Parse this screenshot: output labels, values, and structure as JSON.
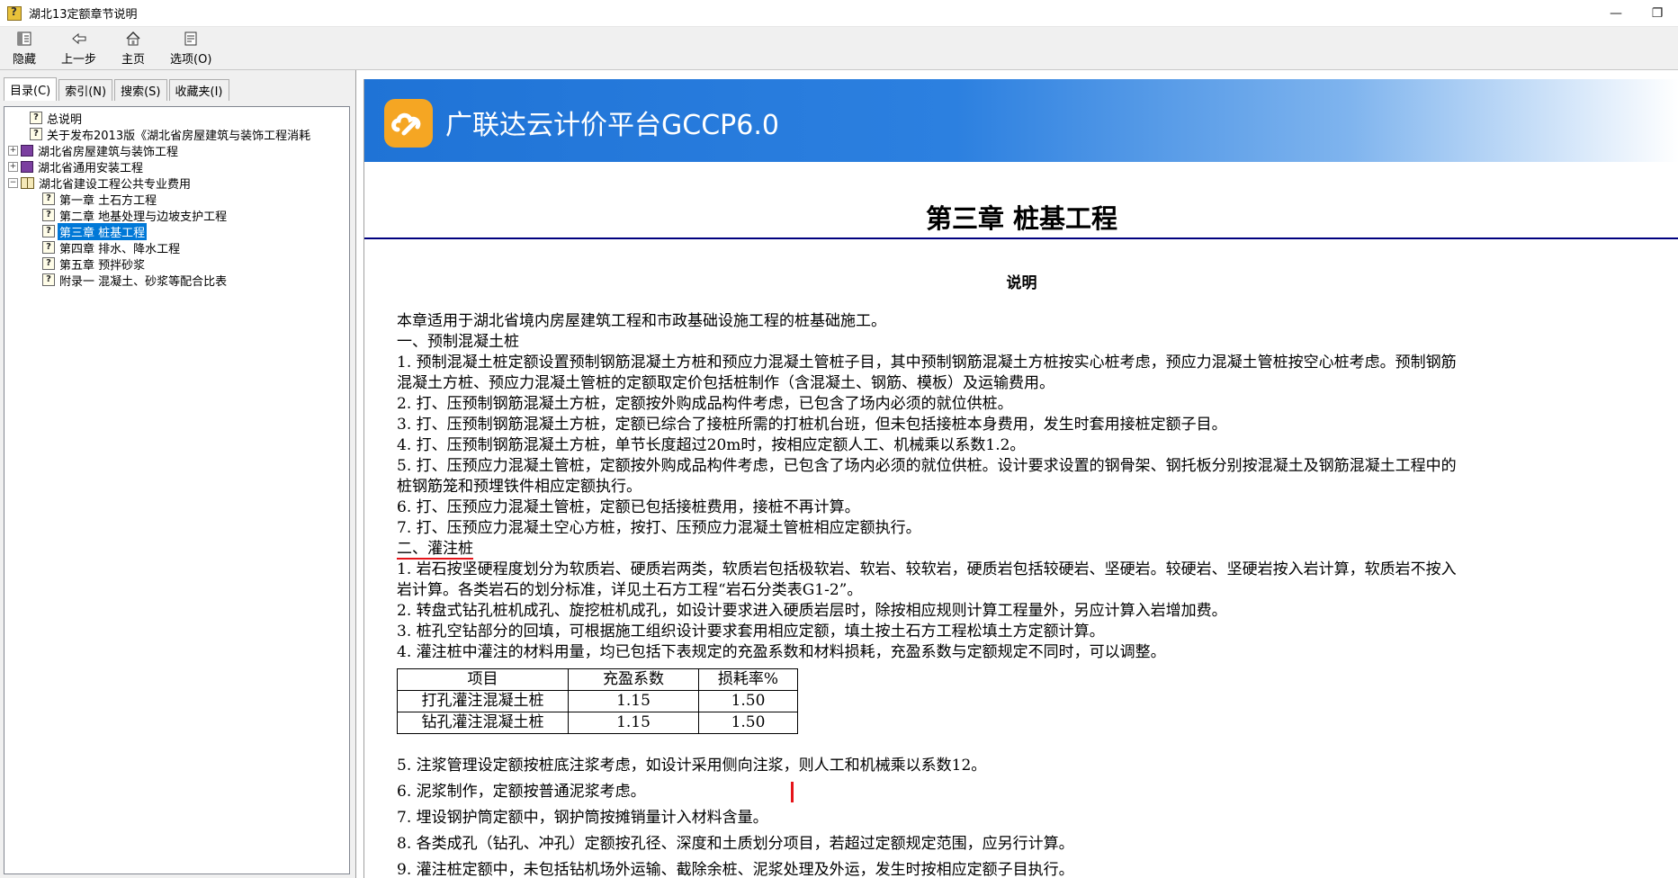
{
  "window": {
    "title": "湖北13定额章节说明",
    "minimize": "—",
    "restore": "❐"
  },
  "toolbar": [
    {
      "label": "隐藏",
      "icon": "hide-icon"
    },
    {
      "label": "上一步",
      "icon": "back-arrow-icon"
    },
    {
      "label": "主页",
      "icon": "home-icon"
    },
    {
      "label": "选项(O)",
      "icon": "options-icon"
    }
  ],
  "tabs": [
    "目录(C)",
    "索引(N)",
    "搜索(S)",
    "收藏夹(I)"
  ],
  "tree": [
    {
      "label": "总说明"
    },
    {
      "label": "关于发布2013版《湖北省房屋建筑与装饰工程消耗"
    },
    {
      "label": "湖北省房屋建筑与装饰工程"
    },
    {
      "label": "湖北省通用安装工程"
    },
    {
      "label": "湖北省建设工程公共专业费用"
    },
    {
      "label": "第一章 土石方工程"
    },
    {
      "label": "第二章 地基处理与边坡支护工程"
    },
    {
      "label": "第三章 桩基工程"
    },
    {
      "label": "第四章 排水、降水工程"
    },
    {
      "label": "第五章 预拌砂浆"
    },
    {
      "label": "附录一 混凝土、砂浆等配合比表"
    }
  ],
  "banner": {
    "title": "广联达云计价平台GCCP6.0"
  },
  "chapter_title": "第三章 桩基工程",
  "section_title": "说明",
  "paragraphs": [
    "本章适用于湖北省境内房屋建筑工程和市政基础设施工程的桩基础施工。",
    "一、预制混凝土桩",
    "1. 预制混凝土桩定额设置预制钢筋混凝土方桩和预应力混凝土管桩子目，其中预制钢筋混凝土方桩按实心桩考虑，预应力混凝土管桩按空心桩考虑。预制钢筋",
    "混凝土方桩、预应力混凝土管桩的定额取定价包括桩制作（含混凝土、钢筋、模板）及运输费用。",
    "2. 打、压预制钢筋混凝土方桩，定额按外购成品构件考虑，已包含了场内必须的就位供桩。",
    "3. 打、压预制钢筋混凝土方桩，定额已综合了接桩所需的打桩机台班，但未包括接桩本身费用，发生时套用接桩定额子目。",
    "4. 打、压预制钢筋混凝土方桩，单节长度超过20m时，按相应定额人工、机械乘以系数1.2。",
    "5. 打、压预应力混凝土管桩，定额按外购成品构件考虑，已包含了场内必须的就位供桩。设计要求设置的钢骨架、钢托板分别按混凝土及钢筋混凝土工程中的",
    "桩钢筋笼和预埋铁件相应定额执行。",
    "6. 打、压预应力混凝土管桩，定额已包括接桩费用，接桩不再计算。",
    "7. 打、压预应力混凝土空心方桩，按打、压预应力混凝土管桩相应定额执行。",
    "二、灌注桩",
    "1. 岩石按坚硬程度划分为软质岩、硬质岩两类，软质岩包括极软岩、软岩、较软岩，硬质岩包括较硬岩、坚硬岩。较硬岩、坚硬岩按入岩计算，软质岩不按入",
    "岩计算。各类岩石的划分标准，详见土石方工程“岩石分类表G1-2”。",
    "2. 转盘式钻孔桩机成孔、旋挖桩机成孔，如设计要求进入硬质岩层时，除按相应规则计算工程量外，另应计算入岩增加费。",
    "3. 桩孔空钻部分的回填，可根据施工组织设计要求套用相应定额，填土按土石方工程松填土方定额计算。",
    "4. 灌注桩中灌注的材料用量，均已包括下表规定的充盈系数和材料损耗，充盈系数与定额规定不同时，可以调整。"
  ],
  "fill_table": {
    "headers": [
      "项目",
      "充盈系数",
      "损耗率%"
    ],
    "rows": [
      [
        "打孔灌注混凝土桩",
        "1.15",
        "1.50"
      ],
      [
        "钻孔灌注混凝土桩",
        "1.15",
        "1.50"
      ]
    ]
  },
  "after_paragraphs": [
    "5. 注浆管理设定额按桩底注浆考虑，如设计采用侧向注浆，则人工和机械乘以系数12。",
    "6. 泥浆制作，定额按普通泥浆考虑。",
    "7. 埋设钢护筒定额中，钢护筒按摊销量计入材料含量。",
    "8. 各类成孔（钻孔、冲孔）定额按孔径、深度和土质划分项目，若超过定额规定范围，应另行计算。",
    "9. 灌注桩定额中，未包括钻机场外运输、截除余桩、泥浆处理及外运，发生时按相应定额子目执行。"
  ],
  "colors": {
    "highlight": "#e5141a",
    "selection": "#0078d7",
    "rule": "#00007f",
    "banner": "#1f73d6"
  }
}
